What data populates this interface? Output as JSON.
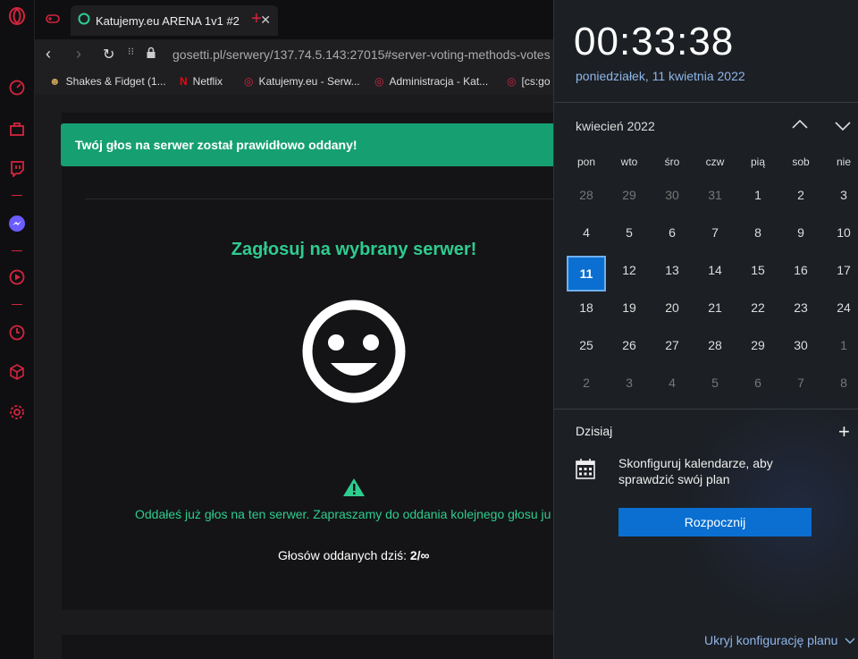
{
  "browser": {
    "tab_title": "Katujemy.eu ARENA 1v1 #2",
    "new_tab_icon": "plus-icon",
    "url": "gosetti.pl/serwery/137.74.5.143:27015#server-voting-methods-votes",
    "bookmarks": [
      {
        "label": "Shakes & Fidget (1..."
      },
      {
        "label": "Netflix"
      },
      {
        "label": "Katujemy.eu - Serw..."
      },
      {
        "label": "Administracja - Kat..."
      },
      {
        "label": "[cs:go"
      }
    ]
  },
  "page": {
    "alert": "Twój głos na serwer został prawidłowo oddany!",
    "heading": "Zagłosuj na wybrany serwer!",
    "warning": "Oddałeś już głos na ten serwer. Zapraszamy do oddania kolejnego głosu ju",
    "votes_label": "Głosów oddanych dziś:",
    "votes_value": "2/∞"
  },
  "calendar": {
    "time": "00:33:38",
    "date": "poniedziałek, 11 kwietnia 2022",
    "month": "kwiecień 2022",
    "weekdays": [
      "pon",
      "wto",
      "śro",
      "czw",
      "pią",
      "sob",
      "nie"
    ],
    "weeks": [
      [
        "28",
        "29",
        "30",
        "31",
        "1",
        "2",
        "3"
      ],
      [
        "4",
        "5",
        "6",
        "7",
        "8",
        "9",
        "10"
      ],
      [
        "11",
        "12",
        "13",
        "14",
        "15",
        "16",
        "17"
      ],
      [
        "18",
        "19",
        "20",
        "21",
        "22",
        "23",
        "24"
      ],
      [
        "25",
        "26",
        "27",
        "28",
        "29",
        "30",
        "1"
      ],
      [
        "2",
        "3",
        "4",
        "5",
        "6",
        "7",
        "8"
      ]
    ],
    "today_label": "Dzisiaj",
    "agenda_text_1": "Skonfiguruj kalendarze, aby",
    "agenda_text_2": "sprawdzić swój plan",
    "start_button": "Rozpocznij",
    "hide_link": "Ukryj konfigurację planu"
  },
  "colors": {
    "accent_green": "#16a072",
    "heading_green": "#2ecc8f",
    "opera_red": "#d4243e",
    "windows_blue": "#0a6fd0"
  }
}
